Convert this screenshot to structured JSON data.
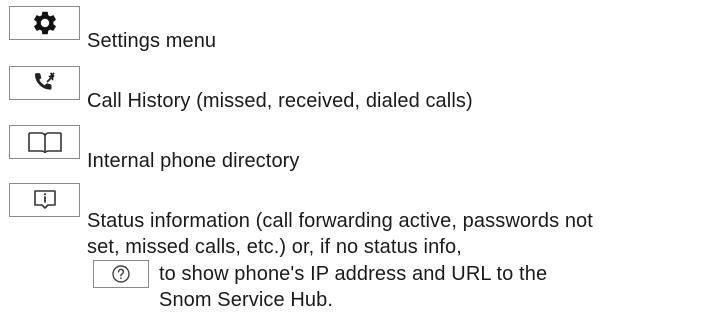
{
  "legend": {
    "items": [
      {
        "icon": "gear-icon",
        "label": "Settings menu"
      },
      {
        "icon": "call-history-icon",
        "label": "Call History (missed, received, dialed calls)"
      },
      {
        "icon": "book-icon",
        "label": "Internal phone directory"
      },
      {
        "icon": "info-icon",
        "lines": [
          "Status information (call forwarding active, passwords not",
          "set, missed calls, etc.) or, if no status info,"
        ]
      }
    ],
    "sub_item": {
      "icon": "help-icon",
      "lines": [
        "to show phone's IP address and URL to the",
        "Snom Service Hub."
      ]
    }
  }
}
